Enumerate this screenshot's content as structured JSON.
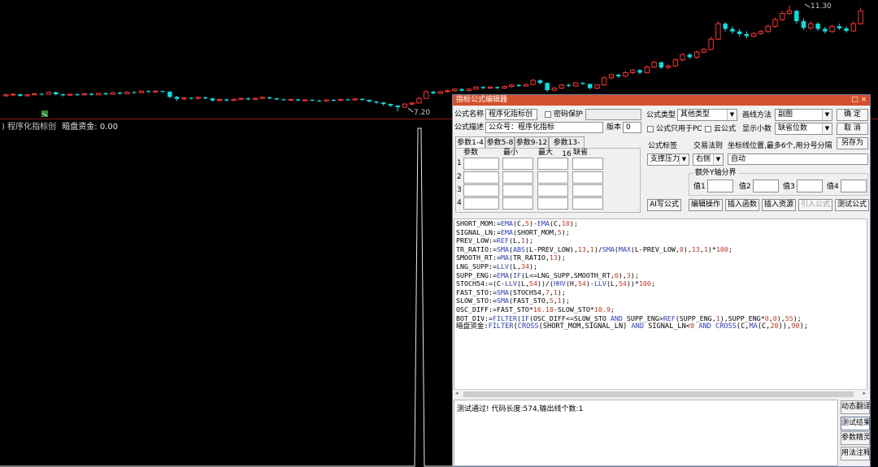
{
  "chart": {
    "high_label": "11.30",
    "low_label": "7.20",
    "colors": {
      "up": "#ff3232",
      "down": "#00e4e4",
      "signal": "#e8e8e8",
      "divider": "#8b1a1a"
    },
    "candles": [
      {
        "o": 7.8,
        "c": 7.84,
        "h": 7.88,
        "l": 7.76
      },
      {
        "o": 7.84,
        "c": 7.86,
        "h": 7.9,
        "l": 7.8
      },
      {
        "o": 7.86,
        "c": 7.8,
        "h": 7.88,
        "l": 7.76
      },
      {
        "o": 7.8,
        "c": 7.84,
        "h": 7.87,
        "l": 7.77
      },
      {
        "o": 7.84,
        "c": 7.88,
        "h": 7.92,
        "l": 7.82
      },
      {
        "o": 7.88,
        "c": 7.86,
        "h": 7.91,
        "l": 7.82
      },
      {
        "o": 7.86,
        "c": 7.94,
        "h": 7.97,
        "l": 7.84
      },
      {
        "o": 7.94,
        "c": 7.86,
        "h": 7.96,
        "l": 7.82
      },
      {
        "o": 7.86,
        "c": 7.82,
        "h": 7.89,
        "l": 7.78
      },
      {
        "o": 7.82,
        "c": 7.86,
        "h": 7.9,
        "l": 7.79
      },
      {
        "o": 7.86,
        "c": 7.84,
        "h": 7.9,
        "l": 7.8
      },
      {
        "o": 7.84,
        "c": 7.88,
        "h": 7.92,
        "l": 7.81
      },
      {
        "o": 7.88,
        "c": 7.84,
        "h": 7.91,
        "l": 7.81
      },
      {
        "o": 7.84,
        "c": 7.9,
        "h": 7.93,
        "l": 7.82
      },
      {
        "o": 7.9,
        "c": 7.86,
        "h": 7.93,
        "l": 7.83
      },
      {
        "o": 7.86,
        "c": 7.92,
        "h": 7.95,
        "l": 7.84
      },
      {
        "o": 7.92,
        "c": 7.88,
        "h": 7.96,
        "l": 7.85
      },
      {
        "o": 7.88,
        "c": 7.94,
        "h": 7.98,
        "l": 7.86
      },
      {
        "o": 7.94,
        "c": 7.92,
        "h": 7.98,
        "l": 7.89
      },
      {
        "o": 7.92,
        "c": 7.98,
        "h": 8.02,
        "l": 7.9
      },
      {
        "o": 7.98,
        "c": 7.96,
        "h": 8.01,
        "l": 7.92
      },
      {
        "o": 7.96,
        "c": 7.98,
        "h": 8.02,
        "l": 7.93
      },
      {
        "o": 7.98,
        "c": 7.96,
        "h": 8.01,
        "l": 7.93
      },
      {
        "o": 7.96,
        "c": 7.76,
        "h": 7.98,
        "l": 7.7
      },
      {
        "o": 7.76,
        "c": 7.68,
        "h": 7.8,
        "l": 7.6
      },
      {
        "o": 7.68,
        "c": 7.72,
        "h": 7.75,
        "l": 7.62
      },
      {
        "o": 7.72,
        "c": 7.7,
        "h": 7.75,
        "l": 7.66
      },
      {
        "o": 7.7,
        "c": 7.74,
        "h": 7.78,
        "l": 7.66
      },
      {
        "o": 7.74,
        "c": 7.7,
        "h": 7.77,
        "l": 7.66
      },
      {
        "o": 7.7,
        "c": 7.62,
        "h": 7.72,
        "l": 7.58
      },
      {
        "o": 7.62,
        "c": 7.66,
        "h": 7.7,
        "l": 7.58
      },
      {
        "o": 7.66,
        "c": 7.62,
        "h": 7.69,
        "l": 7.58
      },
      {
        "o": 7.62,
        "c": 7.66,
        "h": 7.7,
        "l": 7.6
      },
      {
        "o": 7.66,
        "c": 7.7,
        "h": 7.74,
        "l": 7.64
      },
      {
        "o": 7.7,
        "c": 7.66,
        "h": 7.73,
        "l": 7.63
      },
      {
        "o": 7.66,
        "c": 7.7,
        "h": 7.74,
        "l": 7.64
      },
      {
        "o": 7.7,
        "c": 7.74,
        "h": 7.78,
        "l": 7.68
      },
      {
        "o": 7.74,
        "c": 7.7,
        "h": 7.77,
        "l": 7.67
      },
      {
        "o": 7.7,
        "c": 7.66,
        "h": 7.73,
        "l": 7.63
      },
      {
        "o": 7.66,
        "c": 7.64,
        "h": 7.69,
        "l": 7.61
      },
      {
        "o": 7.64,
        "c": 7.66,
        "h": 7.69,
        "l": 7.61
      },
      {
        "o": 7.66,
        "c": 7.62,
        "h": 7.69,
        "l": 7.59
      },
      {
        "o": 7.62,
        "c": 7.64,
        "h": 7.67,
        "l": 7.59
      },
      {
        "o": 7.64,
        "c": 7.62,
        "h": 7.67,
        "l": 7.59
      },
      {
        "o": 7.62,
        "c": 7.6,
        "h": 7.65,
        "l": 7.57
      },
      {
        "o": 7.6,
        "c": 7.64,
        "h": 7.67,
        "l": 7.57
      },
      {
        "o": 7.64,
        "c": 7.62,
        "h": 7.67,
        "l": 7.59
      },
      {
        "o": 7.62,
        "c": 7.66,
        "h": 7.69,
        "l": 7.59
      },
      {
        "o": 7.66,
        "c": 7.64,
        "h": 7.69,
        "l": 7.61
      },
      {
        "o": 7.64,
        "c": 7.68,
        "h": 7.71,
        "l": 7.61
      },
      {
        "o": 7.68,
        "c": 7.64,
        "h": 7.71,
        "l": 7.61
      },
      {
        "o": 7.64,
        "c": 7.58,
        "h": 7.66,
        "l": 7.54
      },
      {
        "o": 7.58,
        "c": 7.54,
        "h": 7.61,
        "l": 7.48
      },
      {
        "o": 7.54,
        "c": 7.48,
        "h": 7.56,
        "l": 7.42
      },
      {
        "o": 7.48,
        "c": 7.42,
        "h": 7.5,
        "l": 7.36
      },
      {
        "o": 7.42,
        "c": 7.36,
        "h": 7.45,
        "l": 7.2
      },
      {
        "o": 7.36,
        "c": 7.48,
        "h": 7.52,
        "l": 7.32
      },
      {
        "o": 7.48,
        "c": 7.52,
        "h": 7.56,
        "l": 7.44
      },
      {
        "o": 7.52,
        "c": 7.7,
        "h": 7.76,
        "l": 7.5
      },
      {
        "o": 7.7,
        "c": 7.96,
        "h": 8.02,
        "l": 7.68
      },
      {
        "o": 7.96,
        "c": 7.9,
        "h": 8.0,
        "l": 7.86
      },
      {
        "o": 7.9,
        "c": 7.96,
        "h": 8.0,
        "l": 7.86
      },
      {
        "o": 7.96,
        "c": 8.0,
        "h": 8.04,
        "l": 7.92
      },
      {
        "o": 8.0,
        "c": 8.06,
        "h": 8.1,
        "l": 7.96
      },
      {
        "o": 8.06,
        "c": 8.0,
        "h": 8.09,
        "l": 7.96
      },
      {
        "o": 8.0,
        "c": 8.06,
        "h": 8.1,
        "l": 7.97
      },
      {
        "o": 8.06,
        "c": 8.14,
        "h": 8.18,
        "l": 8.03
      },
      {
        "o": 8.14,
        "c": 8.1,
        "h": 8.18,
        "l": 8.06
      },
      {
        "o": 8.1,
        "c": 8.14,
        "h": 8.18,
        "l": 8.06
      },
      {
        "o": 8.14,
        "c": 8.1,
        "h": 8.17,
        "l": 8.06
      },
      {
        "o": 8.1,
        "c": 8.16,
        "h": 8.2,
        "l": 8.07
      },
      {
        "o": 8.16,
        "c": 8.22,
        "h": 8.26,
        "l": 8.12
      },
      {
        "o": 8.22,
        "c": 8.18,
        "h": 8.26,
        "l": 8.14
      },
      {
        "o": 8.18,
        "c": 8.24,
        "h": 8.28,
        "l": 8.15
      },
      {
        "o": 8.24,
        "c": 8.4,
        "h": 8.46,
        "l": 8.2
      },
      {
        "o": 8.4,
        "c": 8.3,
        "h": 8.44,
        "l": 8.24
      },
      {
        "o": 8.3,
        "c": 8.02,
        "h": 8.32,
        "l": 7.96
      },
      {
        "o": 8.02,
        "c": 8.1,
        "h": 8.14,
        "l": 7.98
      },
      {
        "o": 8.1,
        "c": 8.22,
        "h": 8.26,
        "l": 8.06
      },
      {
        "o": 8.22,
        "c": 8.18,
        "h": 8.27,
        "l": 8.14
      },
      {
        "o": 8.18,
        "c": 8.3,
        "h": 8.34,
        "l": 8.14
      },
      {
        "o": 8.3,
        "c": 8.26,
        "h": 8.34,
        "l": 8.22
      },
      {
        "o": 8.26,
        "c": 8.1,
        "h": 8.28,
        "l": 8.04
      },
      {
        "o": 8.1,
        "c": 8.22,
        "h": 8.26,
        "l": 8.06
      },
      {
        "o": 8.22,
        "c": 8.5,
        "h": 8.56,
        "l": 8.18
      },
      {
        "o": 8.5,
        "c": 8.62,
        "h": 8.66,
        "l": 8.44
      },
      {
        "o": 8.62,
        "c": 8.56,
        "h": 8.66,
        "l": 8.5
      },
      {
        "o": 8.56,
        "c": 8.7,
        "h": 8.76,
        "l": 8.52
      },
      {
        "o": 8.7,
        "c": 8.8,
        "h": 8.84,
        "l": 8.64
      },
      {
        "o": 8.8,
        "c": 8.7,
        "h": 8.84,
        "l": 8.64
      },
      {
        "o": 8.7,
        "c": 8.92,
        "h": 8.98,
        "l": 8.66
      },
      {
        "o": 8.92,
        "c": 9.1,
        "h": 9.16,
        "l": 8.88
      },
      {
        "o": 9.1,
        "c": 8.9,
        "h": 9.14,
        "l": 8.84
      },
      {
        "o": 8.9,
        "c": 8.96,
        "h": 9.02,
        "l": 8.84
      },
      {
        "o": 8.96,
        "c": 9.2,
        "h": 9.26,
        "l": 8.92
      },
      {
        "o": 9.2,
        "c": 9.4,
        "h": 9.46,
        "l": 9.14
      },
      {
        "o": 9.4,
        "c": 9.3,
        "h": 9.46,
        "l": 9.24
      },
      {
        "o": 9.3,
        "c": 9.5,
        "h": 9.56,
        "l": 9.24
      },
      {
        "o": 9.5,
        "c": 9.6,
        "h": 9.66,
        "l": 9.44
      },
      {
        "o": 9.6,
        "c": 10.0,
        "h": 10.1,
        "l": 9.56
      },
      {
        "o": 10.0,
        "c": 10.6,
        "h": 10.7,
        "l": 9.96
      },
      {
        "o": 10.6,
        "c": 10.4,
        "h": 10.66,
        "l": 10.3
      },
      {
        "o": 10.4,
        "c": 10.3,
        "h": 10.5,
        "l": 10.2
      },
      {
        "o": 10.3,
        "c": 10.2,
        "h": 10.4,
        "l": 10.1
      },
      {
        "o": 10.2,
        "c": 10.12,
        "h": 10.3,
        "l": 10.04
      },
      {
        "o": 10.12,
        "c": 10.22,
        "h": 10.28,
        "l": 10.06
      },
      {
        "o": 10.22,
        "c": 10.3,
        "h": 10.36,
        "l": 10.16
      },
      {
        "o": 10.3,
        "c": 10.5,
        "h": 10.56,
        "l": 10.24
      },
      {
        "o": 10.5,
        "c": 10.76,
        "h": 10.84,
        "l": 10.44
      },
      {
        "o": 10.76,
        "c": 11.0,
        "h": 11.1,
        "l": 10.7
      },
      {
        "o": 11.0,
        "c": 11.1,
        "h": 11.3,
        "l": 10.94
      },
      {
        "o": 11.1,
        "c": 10.7,
        "h": 11.14,
        "l": 10.6
      },
      {
        "o": 10.7,
        "c": 10.44,
        "h": 10.8,
        "l": 10.36
      },
      {
        "o": 10.44,
        "c": 10.6,
        "h": 10.7,
        "l": 10.36
      },
      {
        "o": 10.6,
        "c": 10.4,
        "h": 10.66,
        "l": 10.32
      },
      {
        "o": 10.4,
        "c": 10.3,
        "h": 10.48,
        "l": 10.22
      },
      {
        "o": 10.3,
        "c": 10.5,
        "h": 10.56,
        "l": 10.24
      },
      {
        "o": 10.5,
        "c": 10.42,
        "h": 10.6,
        "l": 10.36
      },
      {
        "o": 10.42,
        "c": 10.32,
        "h": 10.5,
        "l": 10.26
      },
      {
        "o": 10.32,
        "c": 10.6,
        "h": 10.7,
        "l": 10.28
      },
      {
        "o": 10.6,
        "c": 11.1,
        "h": 11.22,
        "l": 10.56
      }
    ]
  },
  "indicator": {
    "name": "程序化指标创",
    "signal_name": "暗盘资金:",
    "signal_value": "0.00"
  },
  "editor": {
    "title": "指标公式编辑器",
    "formula_name_label": "公式名称",
    "formula_name": "程序化指标创",
    "password_label": "密码保护",
    "description_label": "公式描述",
    "description": "公众号：程序化指标",
    "version_label": "版本",
    "version": "0",
    "type_label": "公式类型",
    "type_value": "其他类型",
    "draw_label": "画线方法",
    "draw_value": "副图",
    "pc_only_label": "公式只用于PC",
    "cloud_label": "云公式",
    "decimals_label": "显示小数",
    "decimals_value": "缺省位数",
    "ok_label": "确 定",
    "cancel_label": "取 消",
    "saveas_label": "另存为",
    "tabs": [
      "参数1-4",
      "参数5-8",
      "参数9-12",
      "参数13-16"
    ],
    "param_headers": [
      "参数",
      "最小",
      "最大",
      "缺省"
    ],
    "param_rows": [
      "1",
      "2",
      "3",
      "4"
    ],
    "formula_tag_label": "公式标签",
    "trade_rule_label": "交易法则",
    "coord_label": "坐标线位置,最多6个,用分号分隔",
    "formula_tag_value": "支撑压力",
    "trade_rule_value": "右侧",
    "coord_value": "自动",
    "yaxis_group_label": "额外Y轴分界",
    "yaxis_values": [
      "值1",
      "值2",
      "值3",
      "值4"
    ],
    "ai_button": "AI写公式",
    "edit_button": "编辑操作",
    "insert_func_button": "插入函数",
    "insert_res_button": "插入资源",
    "import_button": "引入公式",
    "test_button": "测试公式",
    "code_lines": [
      "SHORT_MOM:=EMA(C,5)-EMA(C,10);",
      "SIGNAL_LN:=EMA(SHORT_MOM,5);",
      "PREV_LOW:=REF(L,1);",
      "TR_RATIO:=SMA(ABS(L-PREV_LOW),13,1)/SMA(MAX(L-PREV_LOW,0),13,1)*100;",
      "SMOOTH_RT:=MA(TR_RATIO,13);",
      "LNG_SUPP:=LLV(L,34);",
      "SUPP_ENG:=EMA(IF(L<=LNG_SUPP,SMOOTH_RT,0),3);",
      "STOCH54:=(C-LLV(L,54))/(HHV(H,54)-LLV(L,54))*100;",
      "FAST_STO:=SMA(STOCH54,7,1);",
      "SLOW_STO:=SMA(FAST_STO,5,1);",
      "OSC_DIFF:=FAST_STO*16.18-SLOW_STO*10.9;",
      "BOT_DIV:=FILTER(IF(OSC_DIFF<=SLOW_STO AND SUPP_ENG>REF(SUPP_ENG,1),SUPP_ENG*0,0),55);",
      "暗盘资金:FILTER(CROSS(SHORT_MOM,SIGNAL_LN) AND SIGNAL_LN<0 AND CROSS(C,MA(C,20)),90);"
    ],
    "output": "测试通过! 代码长度:574,输出线个数:1",
    "side_buttons": [
      "动态翻译",
      "测试结果",
      "参数精灵",
      "用法注释"
    ]
  }
}
